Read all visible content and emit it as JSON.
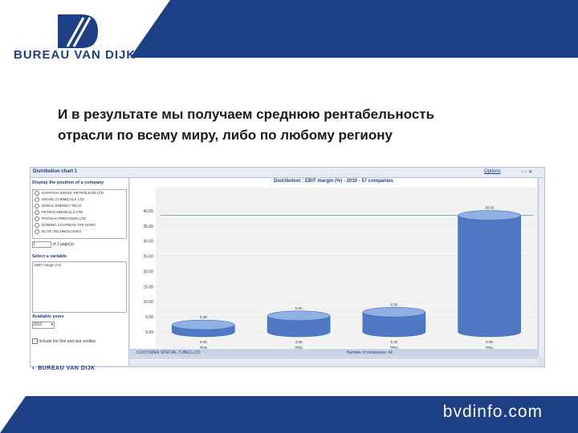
{
  "brand": {
    "name": "BUREAU VAN DIJK",
    "footer_name": "BUREAU VAN DIJK",
    "url": "bvdinfo.com",
    "color": "#1d3f86"
  },
  "headline": {
    "line1": "И в результате мы получаем среднюю рентабельность",
    "line2": "отрасли по всему миру, либо по любому региону"
  },
  "app": {
    "window_title": "Distribution chart 1",
    "options_label": "Options",
    "company_section": "Display the position of a company",
    "companies": [
      "NAPHTHA ISRAEL PETROLEUM LTD",
      "ISRAEL CHEMICALS LTD",
      "DORAL ENERGY TECH",
      "PETROCHEMICALS LTD",
      "POTISHA PRECISION LTD",
      "DOMINO COATINGS TAR DONV",
      "ELITE TECHNOLOGIES"
    ],
    "pager_value": "1",
    "pager_label": "of 2 page(s)",
    "variable_section": "Select a variable",
    "variable_item": "EBIT margin (%)",
    "years_section": "Available years",
    "year_value": "2010",
    "checkbox_label": "Include the first and last centiles",
    "status_left": "CUSTOMER SPECIAL TUBES LTD",
    "status_right": "Number of companies: 42"
  },
  "chart_data": {
    "type": "bar",
    "title": "Distribution : EBIT margin (%) - 2010 - 57 companies",
    "ylim": [
      0,
      45
    ],
    "yticks": [
      "40.00",
      "35.00",
      "30.00",
      "25.00",
      "20.00",
      "15.00",
      "10.00",
      "5.00",
      "0.00"
    ],
    "categories": [
      "25%",
      "25%",
      "25%",
      "25%"
    ],
    "values": [
      2.35,
      5.35,
      6.55,
      38.5
    ],
    "upper_labels": [
      "2.35",
      "5.50",
      "6.55",
      "38.50"
    ],
    "lower_labels": [
      "0.45",
      "3.96",
      "5.30",
      "6.65"
    ],
    "reference_line": 38.5,
    "colors": {
      "bar": "#4f79c4",
      "bar_dark": "#2d5aa6",
      "bar_light": "#8fb0e3",
      "line": "#7fb0b0"
    }
  }
}
